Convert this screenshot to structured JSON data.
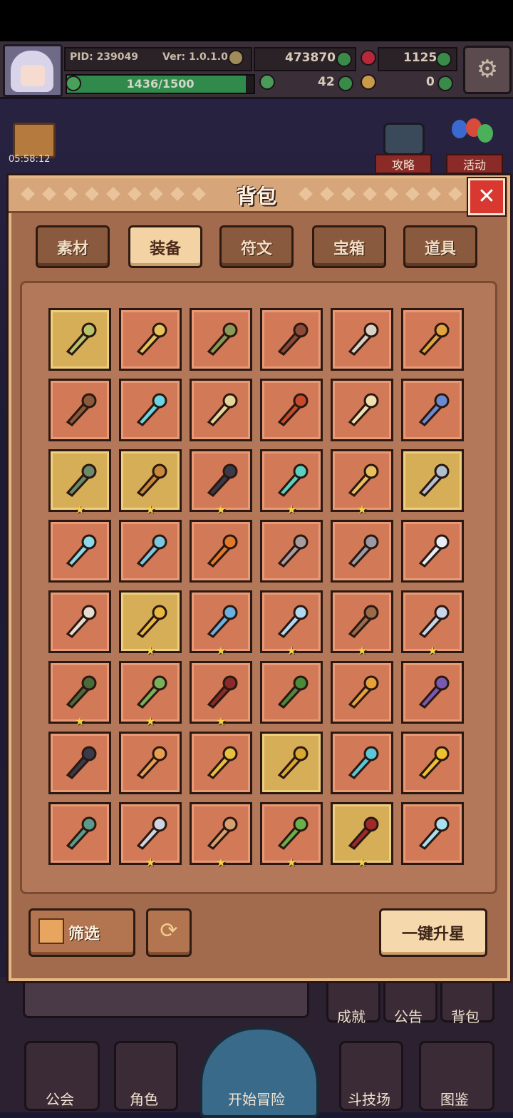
{
  "hud": {
    "pid": "PID: 239049",
    "version": "Ver: 1.0.1.0",
    "gold": "473870",
    "gems": "1125",
    "clover": "42",
    "keys": "0",
    "xp": "1436/1500",
    "xp_progress": 0.957
  },
  "timer": "05:58:12",
  "side_buttons": {
    "guide": "攻略",
    "event": "活动"
  },
  "panel": {
    "title": "背包",
    "close": "✕",
    "tabs": [
      {
        "label": "素材",
        "active": false
      },
      {
        "label": "装备",
        "active": true
      },
      {
        "label": "符文",
        "active": false
      },
      {
        "label": "宝箱",
        "active": false
      },
      {
        "label": "道具",
        "active": false
      }
    ],
    "filter_label": "筛选",
    "upstar_label": "一键升星"
  },
  "items": [
    {
      "name": "staff-icon",
      "gold": true,
      "star": false,
      "color": "#b9c46a"
    },
    {
      "name": "mace-icon",
      "gold": false,
      "star": false,
      "color": "#e6c35a"
    },
    {
      "name": "crossbow-icon",
      "gold": false,
      "star": false,
      "color": "#8a9a56"
    },
    {
      "name": "scepter-icon",
      "gold": false,
      "star": false,
      "color": "#8a4a3a"
    },
    {
      "name": "axe-icon",
      "gold": false,
      "star": false,
      "color": "#d9d2c4"
    },
    {
      "name": "pickaxe-icon",
      "gold": false,
      "star": false,
      "color": "#e0a440"
    },
    {
      "name": "club-icon",
      "gold": false,
      "star": false,
      "color": "#8a5a3a"
    },
    {
      "name": "ice-mace-icon",
      "gold": false,
      "star": false,
      "color": "#6ad4e0"
    },
    {
      "name": "sword-icon",
      "gold": false,
      "star": false,
      "color": "#e6d49a"
    },
    {
      "name": "fire-sword-icon",
      "gold": false,
      "star": false,
      "color": "#c84a2a"
    },
    {
      "name": "golden-sword-icon",
      "gold": false,
      "star": false,
      "color": "#f0e0b0"
    },
    {
      "name": "blue-sword-icon",
      "gold": false,
      "star": false,
      "color": "#6a8ad0"
    },
    {
      "name": "orb-icon",
      "gold": true,
      "star": true,
      "color": "#6a8a6a"
    },
    {
      "name": "spear-icon",
      "gold": true,
      "star": true,
      "color": "#c88a3a"
    },
    {
      "name": "dagger-icon",
      "gold": false,
      "star": true,
      "color": "#3a3a4a"
    },
    {
      "name": "crystal-orb-icon",
      "gold": false,
      "star": true,
      "color": "#5ad0c0"
    },
    {
      "name": "shield-icon",
      "gold": false,
      "star": true,
      "color": "#e8c060"
    },
    {
      "name": "crossed-swords-icon",
      "gold": true,
      "star": false,
      "color": "#b0c0d0"
    },
    {
      "name": "crystal-icon",
      "gold": false,
      "star": false,
      "color": "#8ad8e8"
    },
    {
      "name": "ice-blade-icon",
      "gold": false,
      "star": false,
      "color": "#7ac8e0"
    },
    {
      "name": "crown-icon",
      "gold": false,
      "star": false,
      "color": "#e07a2a"
    },
    {
      "name": "armor-icon",
      "gold": false,
      "star": false,
      "color": "#a89ca0"
    },
    {
      "name": "arrow-icon",
      "gold": false,
      "star": false,
      "color": "#9a9aa6"
    },
    {
      "name": "pearl-icon",
      "gold": false,
      "star": false,
      "color": "#e8ecf4"
    },
    {
      "name": "short-sword-icon",
      "gold": false,
      "star": false,
      "color": "#e8dcd0"
    },
    {
      "name": "gold-crown-icon",
      "gold": true,
      "star": true,
      "color": "#e8b840"
    },
    {
      "name": "ice-helm-icon",
      "gold": false,
      "star": true,
      "color": "#6ab0e0"
    },
    {
      "name": "crystal-crown-icon",
      "gold": false,
      "star": true,
      "color": "#b0d8f0"
    },
    {
      "name": "bronze-helm-icon",
      "gold": false,
      "star": true,
      "color": "#9a6a4a"
    },
    {
      "name": "winged-helm-icon",
      "gold": false,
      "star": true,
      "color": "#c8d4e8"
    },
    {
      "name": "hood-icon",
      "gold": false,
      "star": true,
      "color": "#4a6a3a"
    },
    {
      "name": "circlet-icon",
      "gold": false,
      "star": true,
      "color": "#7ab05a"
    },
    {
      "name": "red-hood-icon",
      "gold": false,
      "star": true,
      "color": "#8a2a2a"
    },
    {
      "name": "green-hat-icon",
      "gold": false,
      "star": false,
      "color": "#4a8a3a"
    },
    {
      "name": "tiara-icon",
      "gold": false,
      "star": false,
      "color": "#e8a03a"
    },
    {
      "name": "purple-helm-icon",
      "gold": false,
      "star": false,
      "color": "#7a5ab0"
    },
    {
      "name": "top-hat-icon",
      "gold": false,
      "star": false,
      "color": "#3a3a4a"
    },
    {
      "name": "necklace-icon",
      "gold": false,
      "star": false,
      "color": "#e8a050"
    },
    {
      "name": "gold-ring-icon",
      "gold": false,
      "star": false,
      "color": "#e8c040"
    },
    {
      "name": "gold-band-icon",
      "gold": true,
      "star": false,
      "color": "#d8a830"
    },
    {
      "name": "cyan-hat-icon",
      "gold": false,
      "star": false,
      "color": "#5ac8d8"
    },
    {
      "name": "gold-cap-icon",
      "gold": false,
      "star": false,
      "color": "#f0c030"
    },
    {
      "name": "teal-armor-icon",
      "gold": false,
      "star": false,
      "color": "#5a9a8a"
    },
    {
      "name": "ornate-armor-icon",
      "gold": false,
      "star": true,
      "color": "#d0d4e0"
    },
    {
      "name": "leather-armor-icon",
      "gold": false,
      "star": true,
      "color": "#d8a070"
    },
    {
      "name": "green-armor-icon",
      "gold": false,
      "star": true,
      "color": "#6ab04a"
    },
    {
      "name": "red-armor-icon",
      "gold": true,
      "star": true,
      "color": "#a02a2a"
    },
    {
      "name": "ice-armor-icon",
      "gold": false,
      "star": false,
      "color": "#a8e0f0"
    }
  ],
  "bottom_nav": {
    "achievements": "成就",
    "notice": "公告",
    "bag": "背包",
    "guild": "公会",
    "character": "角色",
    "start": "开始冒险",
    "arena": "斗技场",
    "codex": "图鉴"
  }
}
